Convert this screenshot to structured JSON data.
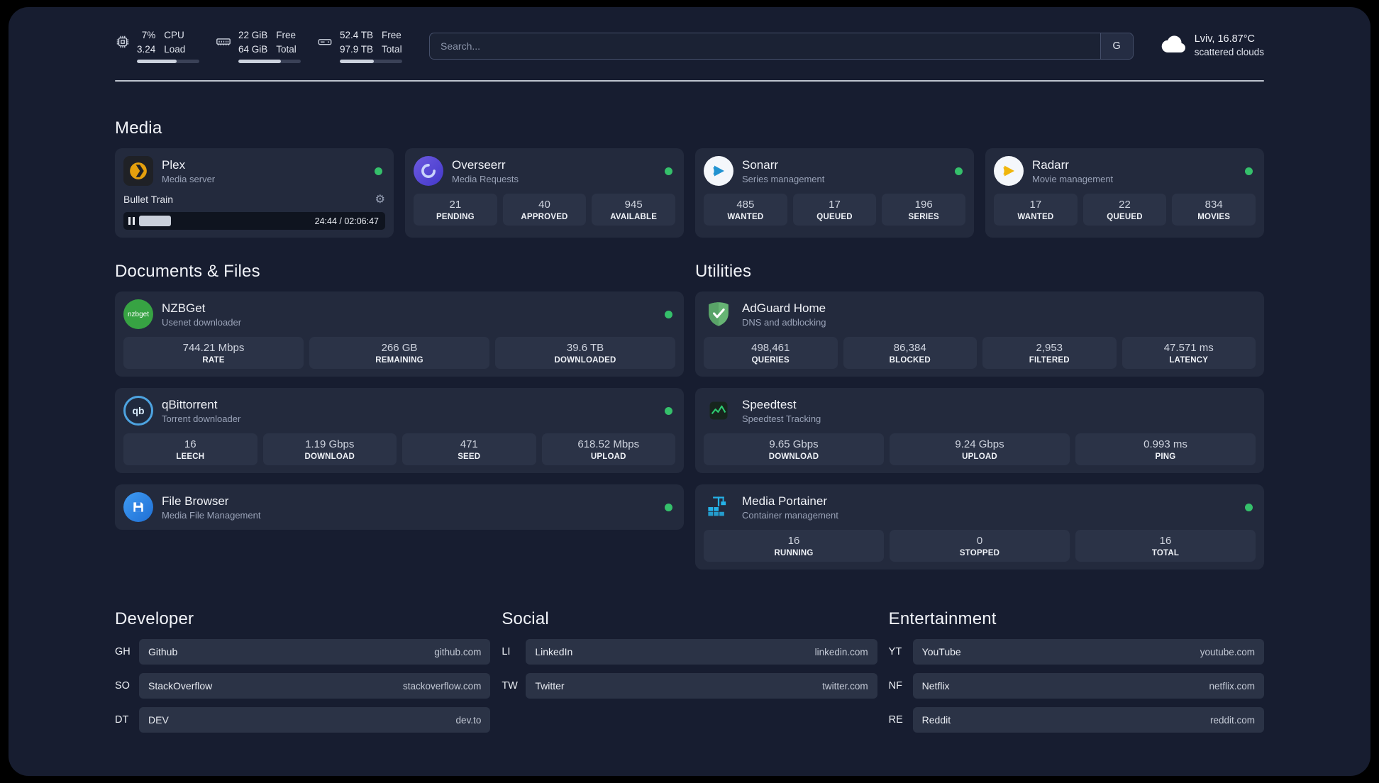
{
  "topbar": {
    "cpu": {
      "value1": "7%",
      "value2": "3.24",
      "label1": "CPU",
      "label2": "Load",
      "bar_percent": 64
    },
    "ram": {
      "value1": "22 GiB",
      "value2": "64 GiB",
      "label1": "Free",
      "label2": "Total",
      "bar_percent": 68
    },
    "disk": {
      "value1": "52.4 TB",
      "value2": "97.9 TB",
      "label1": "Free",
      "label2": "Total",
      "bar_percent": 55
    },
    "search": {
      "placeholder": "Search...",
      "engine": "G"
    },
    "weather": {
      "location": "Lviv, 16.87°C",
      "condition": "scattered clouds"
    }
  },
  "colors": {
    "status_online": "#35c06b",
    "plex_accent": "#e5a00d",
    "page_bg": "#171d30",
    "card_bg": "#232a3d"
  },
  "media": {
    "title": "Media",
    "plex": {
      "name": "Plex",
      "subtitle": "Media server",
      "now_playing": "Bullet Train",
      "time": "24:44 / 02:06:47",
      "progress_percent": 19
    },
    "overseerr": {
      "name": "Overseerr",
      "subtitle": "Media Requests",
      "stats": [
        {
          "value": "21",
          "label": "PENDING"
        },
        {
          "value": "40",
          "label": "APPROVED"
        },
        {
          "value": "945",
          "label": "AVAILABLE"
        }
      ]
    },
    "sonarr": {
      "name": "Sonarr",
      "subtitle": "Series management",
      "stats": [
        {
          "value": "485",
          "label": "WANTED"
        },
        {
          "value": "17",
          "label": "QUEUED"
        },
        {
          "value": "196",
          "label": "SERIES"
        }
      ]
    },
    "radarr": {
      "name": "Radarr",
      "subtitle": "Movie management",
      "stats": [
        {
          "value": "17",
          "label": "WANTED"
        },
        {
          "value": "22",
          "label": "QUEUED"
        },
        {
          "value": "834",
          "label": "MOVIES"
        }
      ]
    }
  },
  "documents": {
    "title": "Documents & Files",
    "nzbget": {
      "name": "NZBGet",
      "subtitle": "Usenet downloader",
      "stats": [
        {
          "value": "744.21 Mbps",
          "label": "RATE"
        },
        {
          "value": "266 GB",
          "label": "REMAINING"
        },
        {
          "value": "39.6 TB",
          "label": "DOWNLOADED"
        }
      ]
    },
    "qbittorrent": {
      "name": "qBittorrent",
      "subtitle": "Torrent downloader",
      "stats": [
        {
          "value": "16",
          "label": "LEECH"
        },
        {
          "value": "1.19 Gbps",
          "label": "DOWNLOAD"
        },
        {
          "value": "471",
          "label": "SEED"
        },
        {
          "value": "618.52 Mbps",
          "label": "UPLOAD"
        }
      ]
    },
    "filebrowser": {
      "name": "File Browser",
      "subtitle": "Media File Management"
    }
  },
  "utilities": {
    "title": "Utilities",
    "adguard": {
      "name": "AdGuard Home",
      "subtitle": "DNS and adblocking",
      "stats": [
        {
          "value": "498,461",
          "label": "QUERIES"
        },
        {
          "value": "86,384",
          "label": "BLOCKED"
        },
        {
          "value": "2,953",
          "label": "FILTERED"
        },
        {
          "value": "47.571 ms",
          "label": "LATENCY"
        }
      ]
    },
    "speedtest": {
      "name": "Speedtest",
      "subtitle": "Speedtest Tracking",
      "stats": [
        {
          "value": "9.65 Gbps",
          "label": "DOWNLOAD"
        },
        {
          "value": "9.24 Gbps",
          "label": "UPLOAD"
        },
        {
          "value": "0.993 ms",
          "label": "PING"
        }
      ]
    },
    "portainer": {
      "name": "Media Portainer",
      "subtitle": "Container management",
      "stats": [
        {
          "value": "16",
          "label": "RUNNING"
        },
        {
          "value": "0",
          "label": "STOPPED"
        },
        {
          "value": "16",
          "label": "TOTAL"
        }
      ]
    }
  },
  "bookmarks": [
    {
      "title": "Developer",
      "links": [
        {
          "abbr": "GH",
          "name": "Github",
          "url": "github.com"
        },
        {
          "abbr": "SO",
          "name": "StackOverflow",
          "url": "stackoverflow.com"
        },
        {
          "abbr": "DT",
          "name": "DEV",
          "url": "dev.to"
        }
      ]
    },
    {
      "title": "Social",
      "links": [
        {
          "abbr": "LI",
          "name": "LinkedIn",
          "url": "linkedin.com"
        },
        {
          "abbr": "TW",
          "name": "Twitter",
          "url": "twitter.com"
        }
      ]
    },
    {
      "title": "Entertainment",
      "links": [
        {
          "abbr": "YT",
          "name": "YouTube",
          "url": "youtube.com"
        },
        {
          "abbr": "NF",
          "name": "Netflix",
          "url": "netflix.com"
        },
        {
          "abbr": "RE",
          "name": "Reddit",
          "url": "reddit.com"
        }
      ]
    }
  ]
}
